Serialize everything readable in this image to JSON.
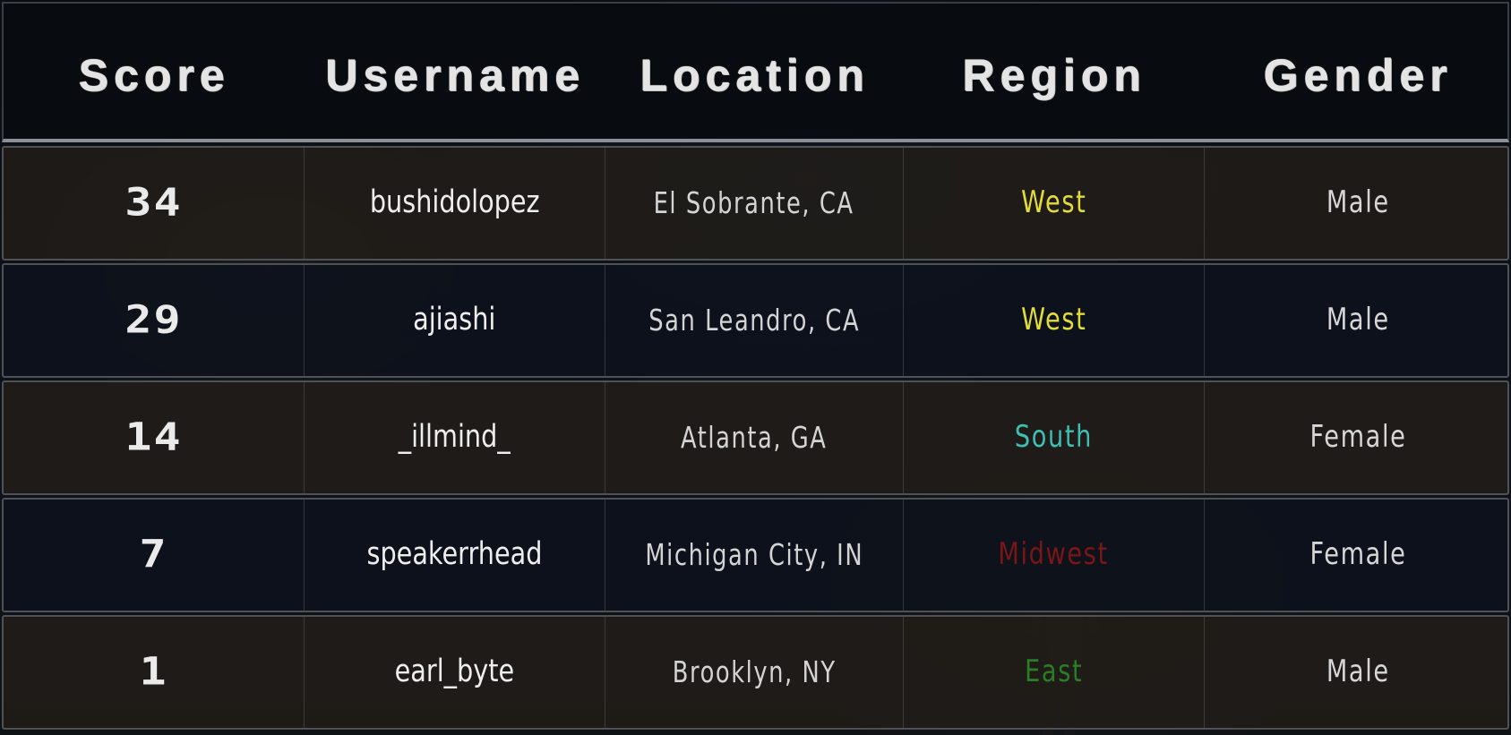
{
  "columns": [
    "Score",
    "Username",
    "Location",
    "Region",
    "Gender"
  ],
  "region_colors": {
    "West": "#e2dc39",
    "South": "#3fbfb3",
    "Midwest": "#7a1616",
    "East": "#2a7d27"
  },
  "rows": [
    {
      "score": "34",
      "username": "bushidolopez",
      "location": "El Sobrante, CA",
      "region": "West",
      "gender": "Male"
    },
    {
      "score": "29",
      "username": "ajiashi",
      "location": "San Leandro, CA",
      "region": "West",
      "gender": "Male"
    },
    {
      "score": "14",
      "username": "_illmind_",
      "location": "Atlanta, GA",
      "region": "South",
      "gender": "Female"
    },
    {
      "score": "7",
      "username": "speakerrhead",
      "location": "Michigan City, IN",
      "region": "Midwest",
      "gender": "Female"
    },
    {
      "score": "1",
      "username": "earl_byte",
      "location": "Brooklyn, NY",
      "region": "East",
      "gender": "Male"
    }
  ]
}
